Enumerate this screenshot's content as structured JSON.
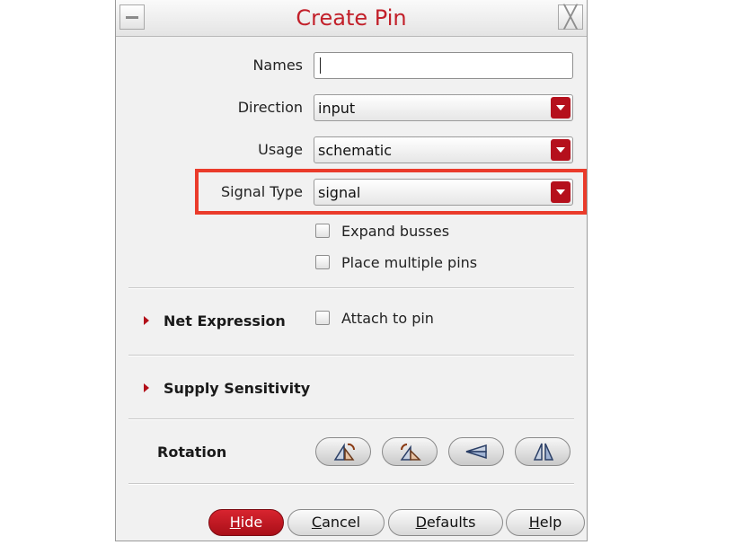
{
  "window": {
    "title": "Create Pin"
  },
  "fields": {
    "names": {
      "label": "Names",
      "value": ""
    },
    "direction": {
      "label": "Direction",
      "value": "input"
    },
    "usage": {
      "label": "Usage",
      "value": "schematic"
    },
    "signal_type": {
      "label": "Signal Type",
      "value": "signal"
    }
  },
  "options": {
    "expand_busses": {
      "label": "Expand busses",
      "checked": false
    },
    "place_multiple_pins": {
      "label": "Place multiple pins",
      "checked": false
    }
  },
  "net_expression": {
    "label": "Net Expression",
    "attach_label": "Attach to pin",
    "attach_checked": false
  },
  "supply_sensitivity": {
    "label": "Supply Sensitivity"
  },
  "rotation": {
    "label": "Rotation",
    "buttons": [
      "rotate-icon",
      "rotate-ccw-icon",
      "sideways-icon",
      "mirror-icon"
    ]
  },
  "buttons": {
    "hide": {
      "mnemonic": "H",
      "rest": "ide"
    },
    "cancel": {
      "mnemonic": "C",
      "rest": "ancel"
    },
    "defaults": {
      "mnemonic": "D",
      "rest": "efaults"
    },
    "help": {
      "mnemonic": "H",
      "rest": "elp"
    }
  },
  "colors": {
    "title": "#c2202a",
    "accent": "#b5101c",
    "highlight": "#ea3b2b"
  }
}
